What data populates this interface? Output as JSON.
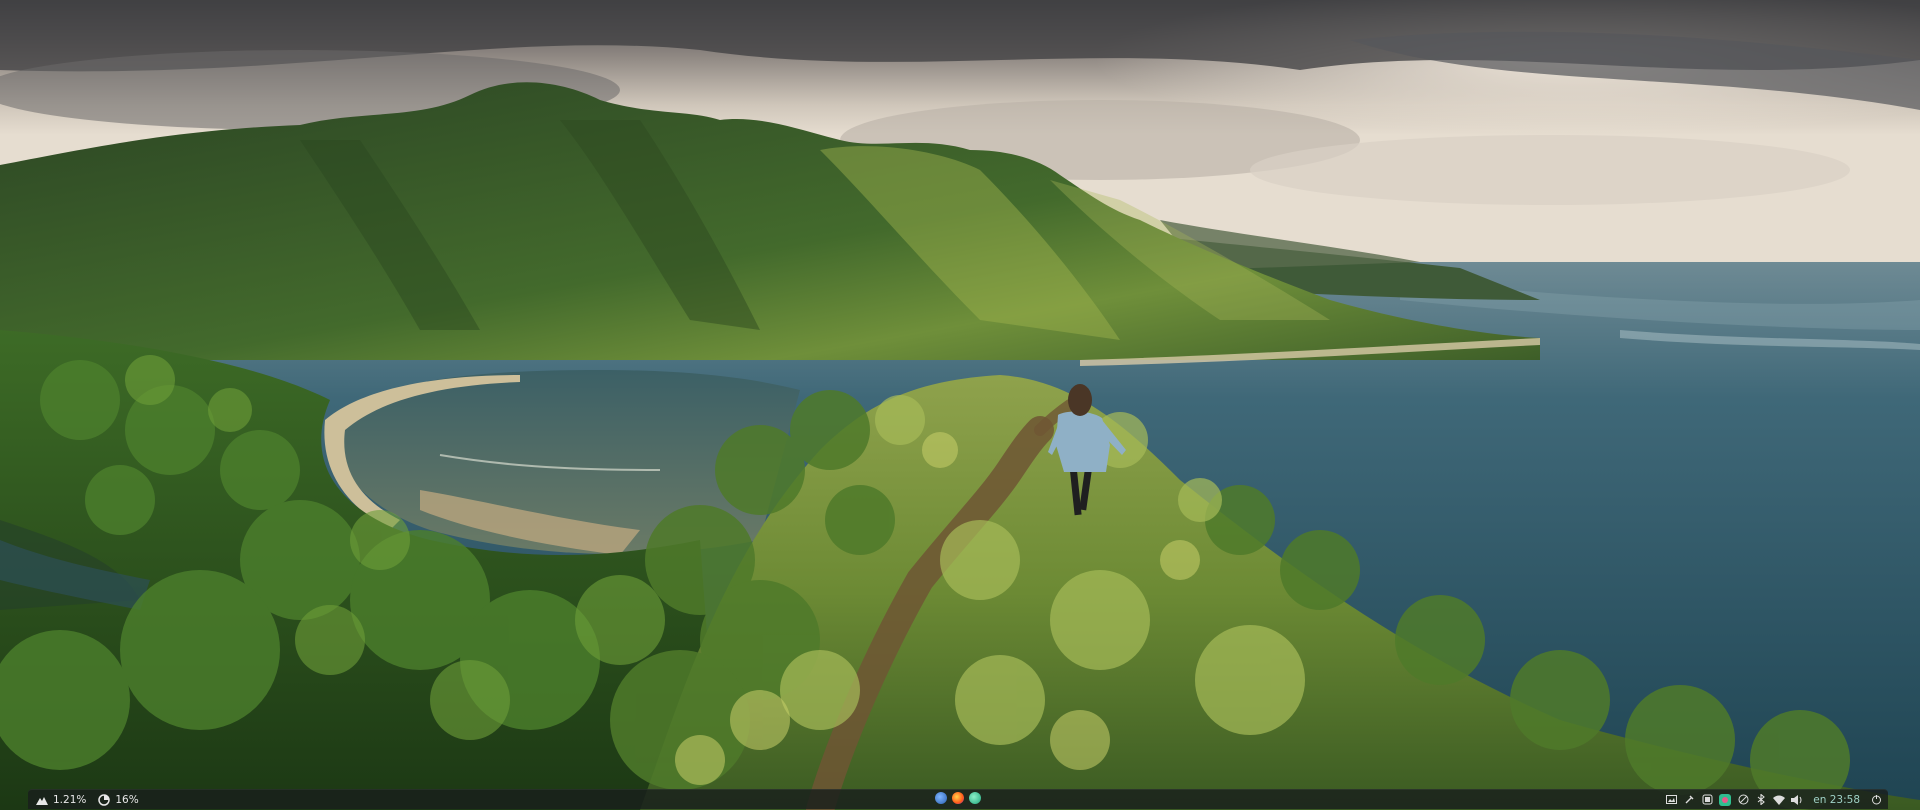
{
  "desktop": {
    "wallpaper": "tropical ridge trail overlooking bay"
  },
  "panel": {
    "cpu": {
      "icon": "cpu-mountain-icon",
      "value": "1.21%"
    },
    "memory": {
      "icon": "memory-pie-icon",
      "value": "16%"
    },
    "apps": [
      {
        "name": "firefox-alt-icon",
        "color": "#3a78c8"
      },
      {
        "name": "firefox-icon",
        "color": "#ff6a1a"
      },
      {
        "name": "chat-app-icon",
        "color": "#2fbf90"
      }
    ],
    "tray": [
      "screenshot-icon",
      "tool-icon",
      "app-indicator-icon",
      "teal-app-icon",
      "vpn-icon",
      "bluetooth-icon",
      "wifi-icon",
      "volume-icon"
    ],
    "clock": "23:58",
    "clock_prefix": "en"
  }
}
